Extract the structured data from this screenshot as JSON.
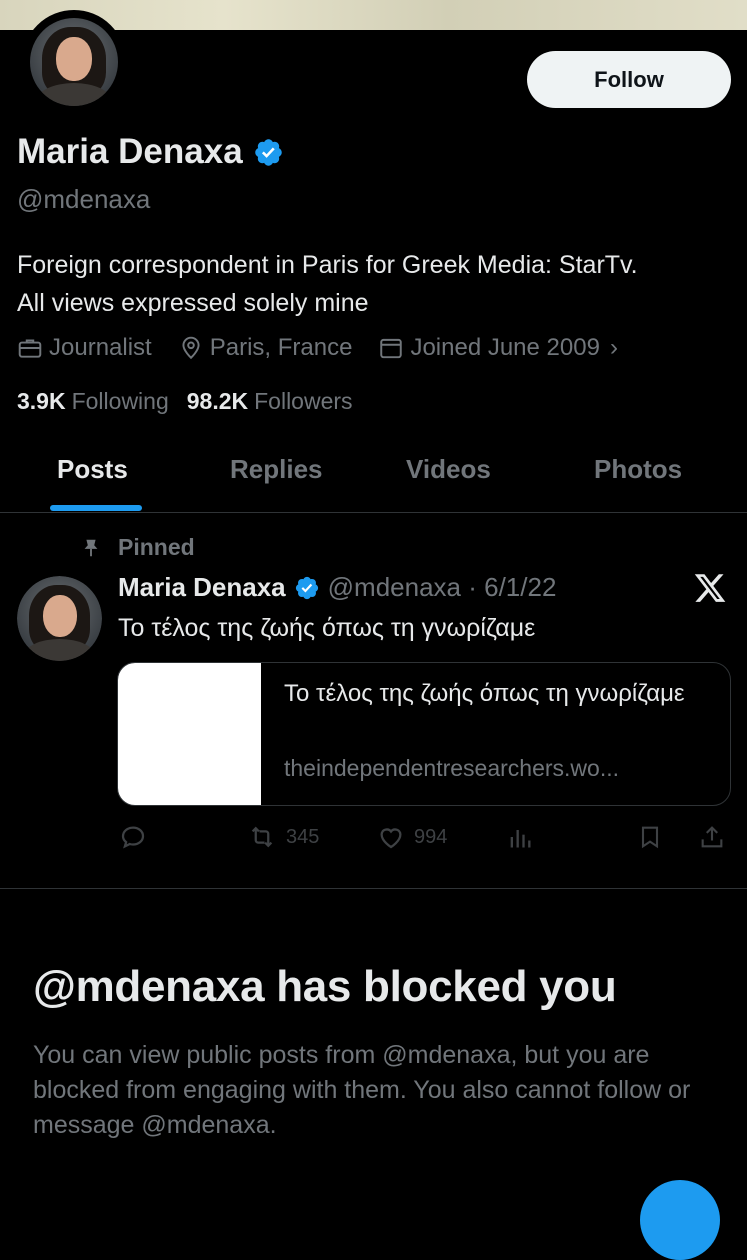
{
  "profile": {
    "name": "Maria Denaxa",
    "handle": "@mdenaxa",
    "follow_label": "Follow",
    "bio_line1": "Foreign correspondent in Paris for Greek Media: StarTv.",
    "bio_line2": "All views expressed solely mine",
    "profession": "Journalist",
    "location": "Paris, France",
    "joined": "Joined June 2009",
    "following_count": "3.9K",
    "following_label": "Following",
    "followers_count": "98.2K",
    "followers_label": "Followers"
  },
  "tabs": [
    {
      "label": "Posts",
      "active": true
    },
    {
      "label": "Replies",
      "active": false
    },
    {
      "label": "Videos",
      "active": false
    },
    {
      "label": "Photos",
      "active": false
    }
  ],
  "pinned_post": {
    "pinned_label": "Pinned",
    "author": "Maria Denaxa",
    "handle_date": "@mdenaxa · 6/1/22",
    "text": "Το τέλος της ζωής όπως τη γνωρίζαμε",
    "card_title": "Το τέλος της ζωής όπως τη γνωρίζαμε",
    "card_url": "theindependentresearchers.wo...",
    "retweets": "345",
    "likes": "994"
  },
  "blocked": {
    "title": "@mdenaxa has blocked you",
    "message": "You can view public posts from @mdenaxa, but you are blocked from engaging with them. You also cannot follow or message @mdenaxa."
  },
  "colors": {
    "background": "#000000",
    "accent": "#1d9bf0",
    "text_primary": "#e7e9ea",
    "text_secondary": "#71767b"
  },
  "icons": [
    "verified-badge-icon",
    "briefcase-icon",
    "location-pin-icon",
    "calendar-icon",
    "chevron-right-icon",
    "pin-icon",
    "x-logo-icon",
    "reply-icon",
    "retweet-icon",
    "like-icon",
    "views-icon",
    "bookmark-icon",
    "share-icon"
  ]
}
